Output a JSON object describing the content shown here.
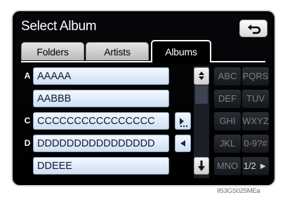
{
  "title": "Select Album",
  "tabs": [
    {
      "label": "Folders",
      "active": false
    },
    {
      "label": "Artists",
      "active": false
    },
    {
      "label": "Albums",
      "active": true
    }
  ],
  "rows": [
    {
      "index": "A",
      "label": "AAAAA"
    },
    {
      "index": "",
      "label": "AABBB"
    },
    {
      "index": "C",
      "label": "CCCCCCCCCCCCCCCC"
    },
    {
      "index": "D",
      "label": "DDDDDDDDDDDDDDDD"
    },
    {
      "index": "",
      "label": "DDEEE"
    }
  ],
  "keyboard": {
    "col1": [
      "ABC",
      "DEF",
      "GHI",
      "JKL",
      "MNO"
    ],
    "col2": [
      "PQRS",
      "TUV",
      "WXYZ",
      "0-9?#",
      "1/2 ►"
    ]
  },
  "caption": "II53GS025MEa",
  "colors": {
    "list_item_bg": "#dce8f7",
    "screen_bg": "#000000",
    "key_text": "#7a7f88"
  },
  "icons": {
    "back": "return-arrow-icon",
    "scroll_up": "scroll-up-icon",
    "scroll_down": "scroll-down-icon",
    "row_c": "more-text-icon",
    "row_d": "left-arrow-icon"
  }
}
